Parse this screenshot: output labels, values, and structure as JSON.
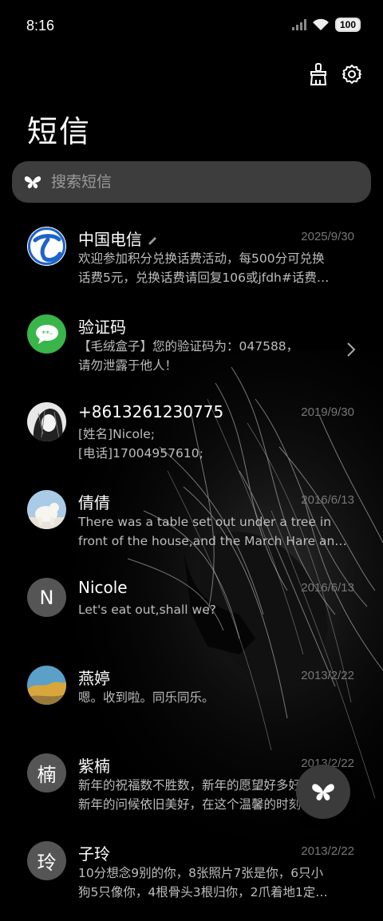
{
  "status_bar": {
    "time": "8:16",
    "battery": "100"
  },
  "header": {
    "title": "短信"
  },
  "search": {
    "placeholder": "搜索短信"
  },
  "conversations": [
    {
      "name": "中国电信",
      "date": "2025/9/30",
      "line1": "欢迎参加积分兑换话费活动，每500分可兑换",
      "line2": "话费5元，兑换话费请回复106或jfdh#话费…",
      "avatar": "china-telecom-logo"
    },
    {
      "name": "验证码",
      "date": "",
      "line1": "【毛绒盒子】您的验证码为：047588，",
      "line2": "请勿泄露于他人！",
      "avatar": "message-bubble-icon"
    },
    {
      "name": "+8613261230775",
      "date": "2019/9/30",
      "line1": "[姓名]Nicole;",
      "line2": "[电话]17004957610;",
      "avatar": "anime-girl-photo"
    },
    {
      "name": "倩倩",
      "date": "2016/6/13",
      "line1": "There was a table set out under a tree in",
      "line2": "front of the house,and the March Hare an…",
      "avatar": "polar-bear-photo"
    },
    {
      "name": "Nicole",
      "date": "2016/6/13",
      "line1": "Let's eat out,shall we?",
      "line2": "",
      "avatar_text": "N"
    },
    {
      "name": "燕婷",
      "date": "2013/2/22",
      "line1": "嗯。收到啦。同乐同乐。",
      "line2": "",
      "avatar": "landscape-photo"
    },
    {
      "name": "紫楠",
      "date": "2013/2/22",
      "line1": "新年的祝福数不胜数，新年的愿望好多好多，",
      "line2": "新年的问候依旧美好，在这个温馨的时刻，…",
      "avatar_text": "楠"
    },
    {
      "name": "子玲",
      "date": "2013/2/22",
      "line1": "10分想念9别的你，8张照片7张是你，6只小",
      "line2": "狗5只像你，4根骨头3根归你，2爪着地1定…",
      "avatar_text": "玲"
    }
  ],
  "colors": {
    "background": "#000000",
    "search_bg": "#3d3d3d",
    "telecom_blue": "#1e63c8",
    "verify_green": "#3ab54a",
    "letter_avatar": "#555555"
  }
}
